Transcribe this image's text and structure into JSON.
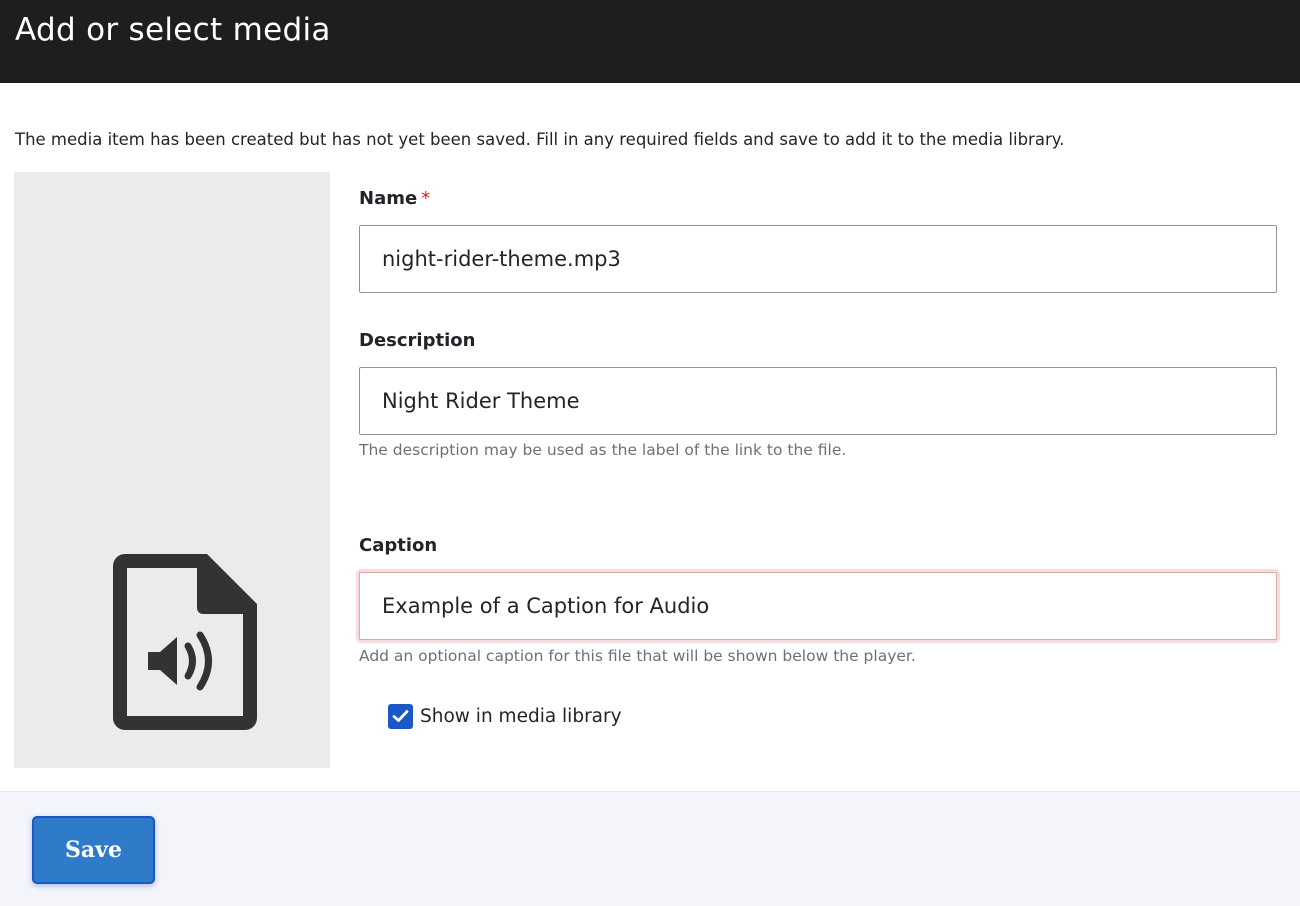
{
  "dialog": {
    "title": "Add or select media"
  },
  "status_message": "The media item has been created but has not yet been saved. Fill in any required fields and save to add it to the media library.",
  "preview": {
    "icon": "audio-file-icon"
  },
  "form": {
    "name": {
      "label": "Name",
      "required_mark": "*",
      "value": "night-rider-theme.mp3"
    },
    "description": {
      "label": "Description",
      "value": "Night Rider Theme",
      "help": "The description may be used as the label of the link to the file."
    },
    "caption": {
      "label": "Caption",
      "value": "Example of a Caption for Audio",
      "help": "Add an optional caption for this file that will be shown below the player."
    },
    "show_in_library": {
      "label": "Show in media library",
      "checked": true
    }
  },
  "actions": {
    "save_label": "Save"
  },
  "colors": {
    "title_bar": "#1e1e1e",
    "primary_button": "#2e7cc9",
    "checkbox": "#1b57c5",
    "required": "#d72222"
  }
}
